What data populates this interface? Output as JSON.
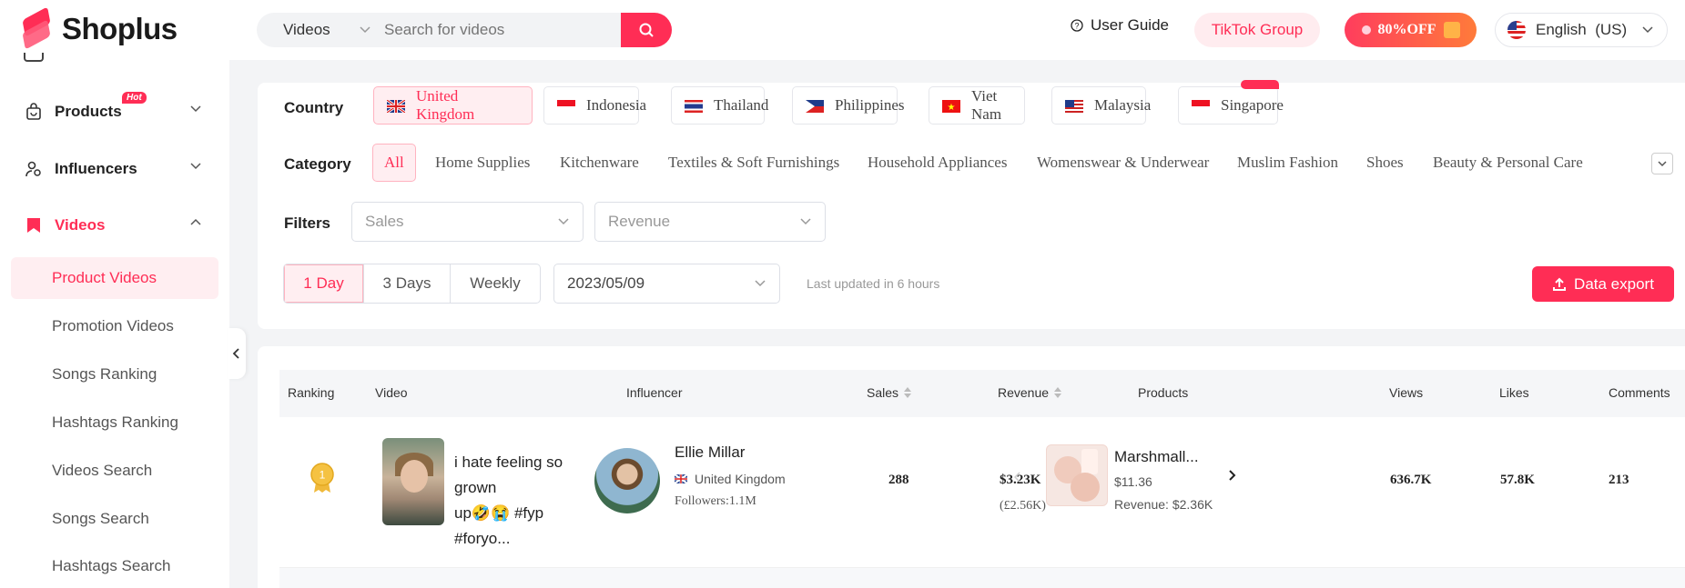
{
  "header": {
    "logo_text": "Shoplus",
    "search_type": "Videos",
    "search_placeholder": "Search for videos",
    "user_guide": "User Guide",
    "tiktok_group": "TikTok Group",
    "promo": "80%OFF",
    "language": "English  (US)"
  },
  "sidebar": {
    "products": "Products",
    "hot_badge": "Hot",
    "influencers": "Influencers",
    "videos": "Videos",
    "sub_items": [
      "Product Videos",
      "Promotion Videos",
      "Songs Ranking",
      "Hashtags Ranking",
      "Videos Search",
      "Songs Search",
      "Hashtags Search"
    ]
  },
  "filters": {
    "country_label": "Country",
    "countries": [
      "United Kingdom",
      "Indonesia",
      "Thailand",
      "Philippines",
      "Viet Nam",
      "Malaysia",
      "Singapore"
    ],
    "category_label": "Category",
    "categories": [
      "All",
      "Home Supplies",
      "Kitchenware",
      "Textiles & Soft Furnishings",
      "Household Appliances",
      "Womenswear & Underwear",
      "Muslim Fashion",
      "Shoes",
      "Beauty & Personal Care"
    ],
    "filters_label": "Filters",
    "sales_placeholder": "Sales",
    "revenue_placeholder": "Revenue",
    "periods": [
      "1 Day",
      "3 Days",
      "Weekly"
    ],
    "date": "2023/05/09",
    "last_updated": "Last updated in 6 hours",
    "export": "Data export"
  },
  "table": {
    "headers": {
      "ranking": "Ranking",
      "video": "Video",
      "influencer": "Influencer",
      "sales": "Sales",
      "revenue": "Revenue",
      "products": "Products",
      "views": "Views",
      "likes": "Likes",
      "comments": "Comments"
    },
    "rows": [
      {
        "rank": "1",
        "video_title_line1": "i hate feeling so grown",
        "video_title_line2": "up🤣😭 #fyp #foryo...",
        "influencer_name": "Ellie Millar",
        "influencer_country": "United Kingdom",
        "followers": "Followers:1.1M",
        "sales": "288",
        "revenue": "$3.23K",
        "revenue_local": "(£2.56K)",
        "product_name": "Marshmall...",
        "product_price": "$11.36",
        "product_revenue": "Revenue: $2.36K",
        "views": "636.7K",
        "likes": "57.8K",
        "comments": "213"
      }
    ]
  },
  "colors": {
    "accent": "#ff2d55",
    "accent_light": "#ffeef1"
  }
}
